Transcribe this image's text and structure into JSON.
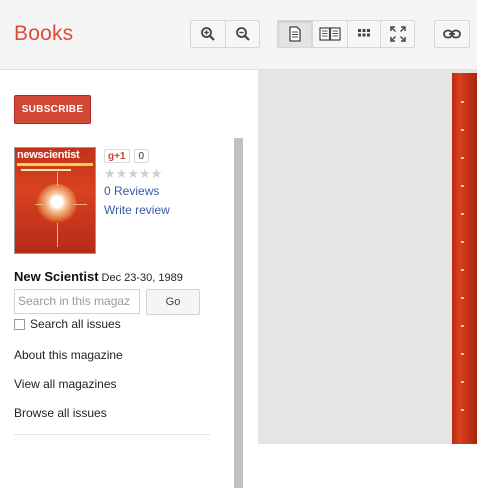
{
  "header": {
    "logo": "Books",
    "toolbar": {
      "zoom_in": "zoom-in-icon",
      "zoom_out": "zoom-out-icon",
      "single_page": "single-page-icon",
      "two_page": "two-page-icon",
      "thumbnails": "grid-icon",
      "fullscreen": "fullscreen-icon",
      "link": "link-icon"
    }
  },
  "sidebar": {
    "subscribe_label": "SUBSCRIBE",
    "cover": {
      "masthead": "newscientist"
    },
    "gplus": {
      "label": "g+1",
      "count": "0"
    },
    "rating": {
      "stars": "★★★★★",
      "value": 0
    },
    "reviews_link": "0 Reviews",
    "write_review_link": "Write review",
    "magazine": {
      "title": "New Scientist",
      "issue": "Dec 23-30, 1989"
    },
    "search": {
      "placeholder": "Search in this magaz",
      "button": "Go"
    },
    "search_all_label": "Search all issues",
    "links": [
      "About this magazine",
      "View all magazines",
      "Browse all issues"
    ]
  },
  "colors": {
    "brand": "#dd4b39",
    "subscribe_bg": "#d14836",
    "link": "#3b5aa6",
    "viewer_bg": "#e5e5e5"
  }
}
